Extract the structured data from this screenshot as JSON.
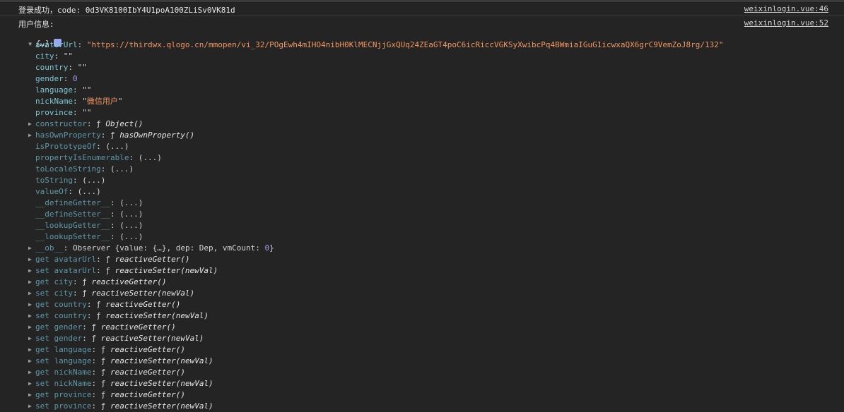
{
  "log1": {
    "text": "登录成功，code: 0d3VK8100IbY4U1poA100ZLiSv0VK81d",
    "source": "weixinlogin.vue:46"
  },
  "log2": {
    "label": "用户信息:",
    "source": "weixinlogin.vue:52",
    "object_preview": "{…}",
    "rows": [
      {
        "expand": false,
        "key": "avatarUrl",
        "sep": ": ",
        "val": "\"https://thirdwx.qlogo.cn/mmopen/vi_32/POgEwh4mIHO4nibH0KlMECNjjGxQUq24ZEaGT4poC6icRiccVGKSyXwibcPq4BWmiaIGuG1icwxaQX6grC9VemZoJ8rg/132\"",
        "vtype": "str",
        "kstyle": "k"
      },
      {
        "expand": false,
        "key": "city",
        "sep": ": ",
        "val": "\"\"",
        "vtype": "plain",
        "kstyle": "k"
      },
      {
        "expand": false,
        "key": "country",
        "sep": ": ",
        "val": "\"\"",
        "vtype": "plain",
        "kstyle": "k"
      },
      {
        "expand": false,
        "key": "gender",
        "sep": ": ",
        "val": "0",
        "vtype": "num",
        "kstyle": "k"
      },
      {
        "expand": false,
        "key": "language",
        "sep": ": ",
        "val": "\"\"",
        "vtype": "plain",
        "kstyle": "k"
      },
      {
        "expand": false,
        "key": "nickName",
        "sep": ": ",
        "val": "\"微信用户\"",
        "vtype": "strcn",
        "kstyle": "k"
      },
      {
        "expand": false,
        "key": "province",
        "sep": ": ",
        "val": "\"\"",
        "vtype": "plain",
        "kstyle": "k"
      },
      {
        "expand": true,
        "key": "constructor",
        "sep": ": ",
        "val": "ƒ Object()",
        "vtype": "fn",
        "kstyle": "k-dim"
      },
      {
        "expand": true,
        "key": "hasOwnProperty",
        "sep": ": ",
        "val": "ƒ hasOwnProperty()",
        "vtype": "fn",
        "kstyle": "k-dim"
      },
      {
        "expand": false,
        "key": "isPrototypeOf",
        "sep": ": ",
        "val": "(...)",
        "vtype": "plain",
        "kstyle": "k-dim"
      },
      {
        "expand": false,
        "key": "propertyIsEnumerable",
        "sep": ": ",
        "val": "(...)",
        "vtype": "plain",
        "kstyle": "k-dim"
      },
      {
        "expand": false,
        "key": "toLocaleString",
        "sep": ": ",
        "val": "(...)",
        "vtype": "plain",
        "kstyle": "k-dim"
      },
      {
        "expand": false,
        "key": "toString",
        "sep": ": ",
        "val": "(...)",
        "vtype": "plain",
        "kstyle": "k-dim"
      },
      {
        "expand": false,
        "key": "valueOf",
        "sep": ": ",
        "val": "(...)",
        "vtype": "plain",
        "kstyle": "k-dim"
      },
      {
        "expand": false,
        "key": "__defineGetter__",
        "sep": ": ",
        "val": "(...)",
        "vtype": "plain",
        "kstyle": "k-dim"
      },
      {
        "expand": false,
        "key": "__defineSetter__",
        "sep": ": ",
        "val": "(...)",
        "vtype": "plain",
        "kstyle": "k-dim"
      },
      {
        "expand": false,
        "key": "__lookupGetter__",
        "sep": ": ",
        "val": "(...)",
        "vtype": "plain",
        "kstyle": "k-dim"
      },
      {
        "expand": false,
        "key": "__lookupSetter__",
        "sep": ": ",
        "val": "(...)",
        "vtype": "plain",
        "kstyle": "k-dim"
      },
      {
        "expand": true,
        "key": "__ob__",
        "sep": ": ",
        "val": "Observer {value: {…}, dep: Dep, vmCount: ",
        "val_num": "0",
        "val_tail": "}",
        "vtype": "observer",
        "kstyle": "k-dim"
      },
      {
        "expand": true,
        "key": "get avatarUrl",
        "sep": ": ",
        "val": "ƒ reactiveGetter()",
        "vtype": "fn",
        "kstyle": "k-get"
      },
      {
        "expand": true,
        "key": "set avatarUrl",
        "sep": ": ",
        "val": "ƒ reactiveSetter(newVal)",
        "vtype": "fn",
        "kstyle": "k-get"
      },
      {
        "expand": true,
        "key": "get city",
        "sep": ": ",
        "val": "ƒ reactiveGetter()",
        "vtype": "fn",
        "kstyle": "k-get"
      },
      {
        "expand": true,
        "key": "set city",
        "sep": ": ",
        "val": "ƒ reactiveSetter(newVal)",
        "vtype": "fn",
        "kstyle": "k-get"
      },
      {
        "expand": true,
        "key": "get country",
        "sep": ": ",
        "val": "ƒ reactiveGetter()",
        "vtype": "fn",
        "kstyle": "k-get"
      },
      {
        "expand": true,
        "key": "set country",
        "sep": ": ",
        "val": "ƒ reactiveSetter(newVal)",
        "vtype": "fn",
        "kstyle": "k-get"
      },
      {
        "expand": true,
        "key": "get gender",
        "sep": ": ",
        "val": "ƒ reactiveGetter()",
        "vtype": "fn",
        "kstyle": "k-get"
      },
      {
        "expand": true,
        "key": "set gender",
        "sep": ": ",
        "val": "ƒ reactiveSetter(newVal)",
        "vtype": "fn",
        "kstyle": "k-get"
      },
      {
        "expand": true,
        "key": "get language",
        "sep": ": ",
        "val": "ƒ reactiveGetter()",
        "vtype": "fn",
        "kstyle": "k-get"
      },
      {
        "expand": true,
        "key": "set language",
        "sep": ": ",
        "val": "ƒ reactiveSetter(newVal)",
        "vtype": "fn",
        "kstyle": "k-get"
      },
      {
        "expand": true,
        "key": "get nickName",
        "sep": ": ",
        "val": "ƒ reactiveGetter()",
        "vtype": "fn",
        "kstyle": "k-get"
      },
      {
        "expand": true,
        "key": "set nickName",
        "sep": ": ",
        "val": "ƒ reactiveSetter(newVal)",
        "vtype": "fn",
        "kstyle": "k-get"
      },
      {
        "expand": true,
        "key": "get province",
        "sep": ": ",
        "val": "ƒ reactiveGetter()",
        "vtype": "fn",
        "kstyle": "k-get"
      },
      {
        "expand": true,
        "key": "set province",
        "sep": ": ",
        "val": "ƒ reactiveSetter(newVal)",
        "vtype": "fn",
        "kstyle": "k-get"
      }
    ]
  },
  "colors": {
    "background": "#242424",
    "key": "#7ec7d8",
    "key_dim": "#5f97a8",
    "string": "#f29766",
    "number": "#a39bf0",
    "info_badge": "#9aa6f0"
  },
  "icons": {
    "expanded": "triangle-down-icon",
    "collapsed": "triangle-right-icon",
    "info": "info-badge-icon"
  }
}
